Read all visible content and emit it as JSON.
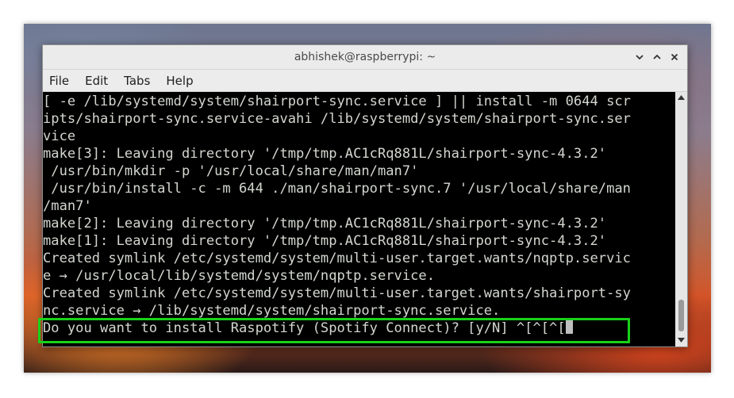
{
  "window": {
    "title": "abhishek@raspberrypi: ~"
  },
  "menu": {
    "items": [
      "File",
      "Edit",
      "Tabs",
      "Help"
    ]
  },
  "terminal": {
    "lines": [
      "[ -e /lib/systemd/system/shairport-sync.service ] || install -m 0644 scr",
      "ipts/shairport-sync.service-avahi /lib/systemd/system/shairport-sync.ser",
      "vice",
      "make[3]: Leaving directory '/tmp/tmp.AC1cRq881L/shairport-sync-4.3.2'",
      " /usr/bin/mkdir -p '/usr/local/share/man/man7'",
      " /usr/bin/install -c -m 644 ./man/shairport-sync.7 '/usr/local/share/man",
      "/man7'",
      "make[2]: Leaving directory '/tmp/tmp.AC1cRq881L/shairport-sync-4.3.2'",
      "make[1]: Leaving directory '/tmp/tmp.AC1cRq881L/shairport-sync-4.3.2'",
      "Created symlink /etc/systemd/system/multi-user.target.wants/nqptp.servic",
      "e → /usr/local/lib/systemd/system/nqptp.service.",
      "Created symlink /etc/systemd/system/multi-user.target.wants/shairport-sy",
      "nc.service → /lib/systemd/system/shairport-sync.service."
    ],
    "prompt": "Do you want to install Raspotify (Spotify Connect)? [y/N] ^[^[^["
  },
  "colors": {
    "highlight": "#19d119",
    "terminal_fg": "#d3d7cf",
    "terminal_bg": "#000000"
  },
  "icons": {
    "minimize": "chevron-down-icon",
    "maximize": "chevron-up-icon",
    "close": "close-icon"
  }
}
